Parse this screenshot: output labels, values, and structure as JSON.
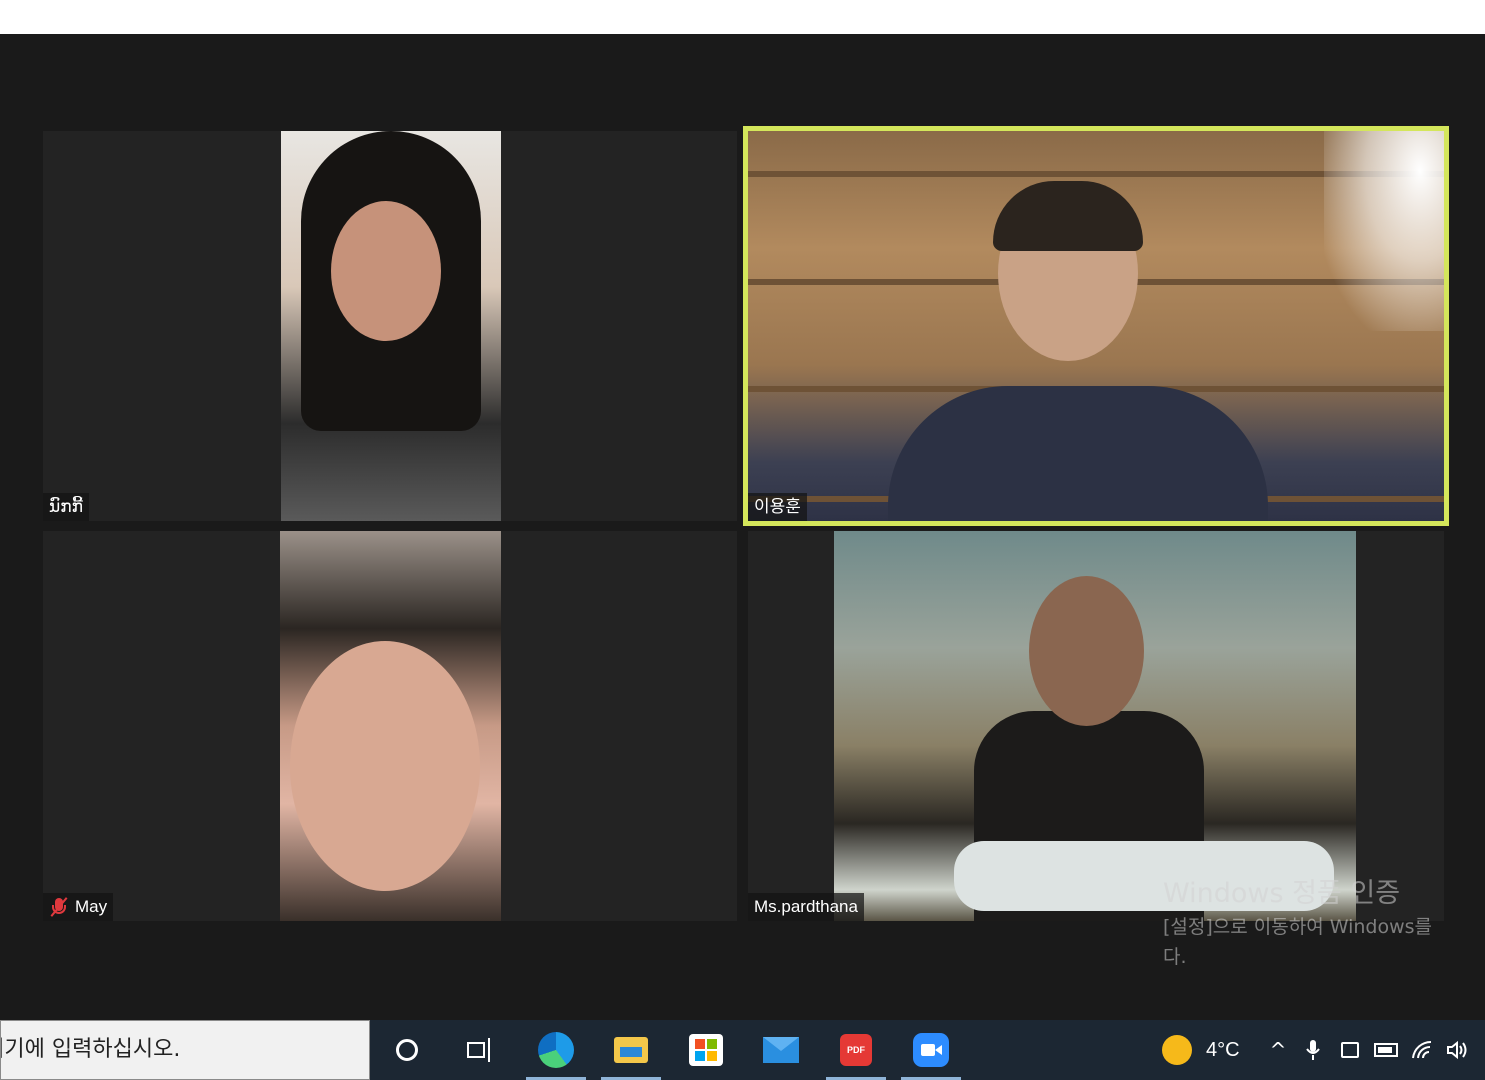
{
  "meeting": {
    "participants": [
      {
        "name": "ນົກກີ້",
        "muted": false,
        "active_speaker": false
      },
      {
        "name": "이용훈",
        "muted": false,
        "active_speaker": true
      },
      {
        "name": "May",
        "muted": true,
        "active_speaker": false
      },
      {
        "name": "Ms.pardthana",
        "muted": false,
        "active_speaker": false
      }
    ],
    "active_speaker_border_color": "#d4e65b"
  },
  "activation_watermark": {
    "line1": "Windows 정품 인증",
    "line2": "[설정]으로 이동하여 Windows를",
    "line3": "다."
  },
  "taskbar": {
    "search_placeholder": "검색하려면 여기에 입력하십시오.",
    "apps": [
      {
        "icon": "cortana-icon"
      },
      {
        "icon": "task-view-icon"
      },
      {
        "icon": "edge-icon"
      },
      {
        "icon": "file-explorer-icon"
      },
      {
        "icon": "microsoft-store-icon"
      },
      {
        "icon": "mail-icon"
      },
      {
        "icon": "pdf-app-icon",
        "label": "PDF"
      },
      {
        "icon": "zoom-icon"
      }
    ],
    "weather": {
      "temperature": "4°C",
      "icon": "sun-icon"
    },
    "tray": {
      "chevron": "^"
    }
  }
}
